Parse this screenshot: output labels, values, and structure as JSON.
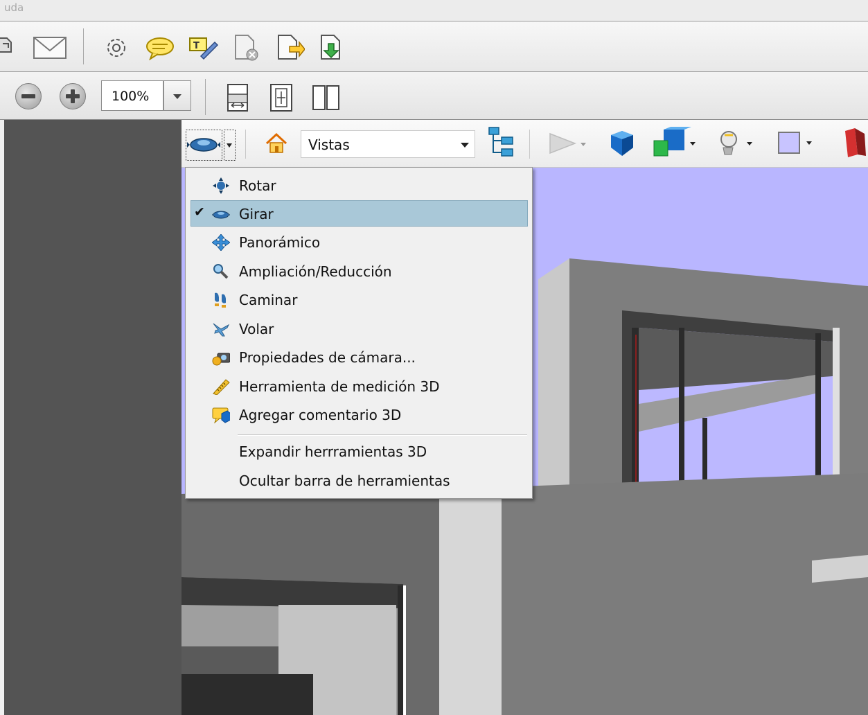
{
  "titlebar": {
    "text": "uda"
  },
  "toolbar1": {
    "icons": [
      "print-icon",
      "email-icon",
      "settings-icon",
      "comment-icon",
      "sign-icon",
      "document-delete-icon",
      "document-export-icon",
      "document-save-icon"
    ]
  },
  "toolbar2": {
    "zoom_value": "100%",
    "icons": [
      "zoom-out-icon",
      "zoom-in-icon",
      "fit-page-icon",
      "fit-width-icon",
      "two-pages-icon"
    ]
  },
  "toolbar3d": {
    "views_label": "Vistas",
    "icons": [
      "girar-tool-icon",
      "home-view-icon",
      "model-tree-icon",
      "play-animation-icon",
      "render-mode-icon",
      "projection-icon",
      "lighting-icon",
      "background-color-icon",
      "cross-section-icon"
    ]
  },
  "menu": {
    "items": [
      {
        "label": "Rotar",
        "icon": "rotate-icon",
        "checked": false
      },
      {
        "label": "Girar",
        "icon": "spin-icon",
        "checked": true
      },
      {
        "label": "Panorámico",
        "icon": "pan-icon",
        "checked": false
      },
      {
        "label": "Ampliación/Reducción",
        "icon": "zoom-icon",
        "checked": false
      },
      {
        "label": "Caminar",
        "icon": "walk-icon",
        "checked": false
      },
      {
        "label": "Volar",
        "icon": "fly-icon",
        "checked": false
      },
      {
        "label": "Propiedades de cámara...",
        "icon": "camera-icon",
        "checked": false
      },
      {
        "label": "Herramienta de medición 3D",
        "icon": "measure-icon",
        "checked": false
      },
      {
        "label": "Agregar comentario 3D",
        "icon": "comment-3d-icon",
        "checked": false
      }
    ],
    "extra_items": [
      {
        "label": "Expandir herrramientas 3D"
      },
      {
        "label": "Ocultar barra de herramientas"
      }
    ],
    "check_mark": "✔"
  }
}
